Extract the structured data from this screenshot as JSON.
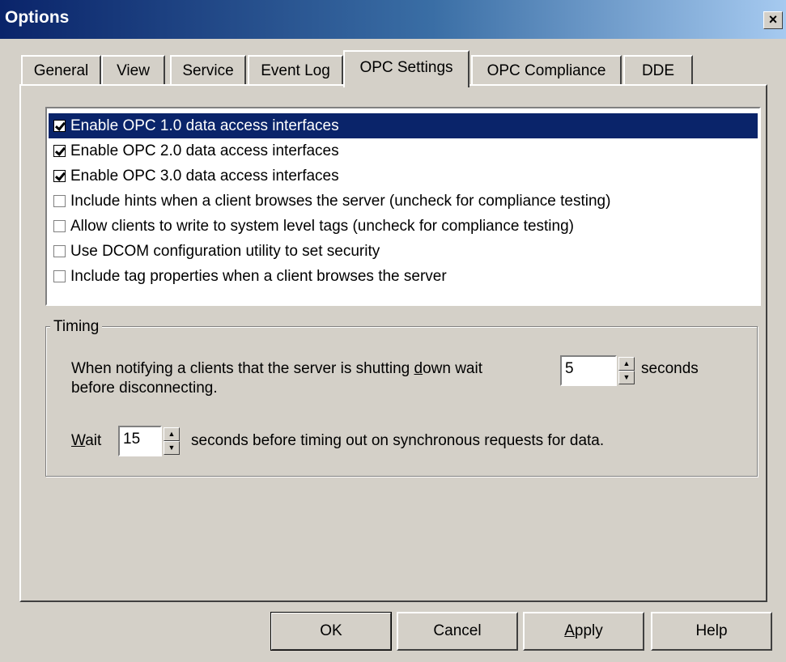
{
  "window": {
    "title": "Options",
    "close_glyph": "×"
  },
  "tabs": [
    {
      "label": "General"
    },
    {
      "label": "View"
    },
    {
      "label": "Service"
    },
    {
      "label": "Event Log"
    },
    {
      "label": "OPC Settings",
      "active": true
    },
    {
      "label": "OPC Compliance"
    },
    {
      "label": "DDE"
    }
  ],
  "options": [
    {
      "label": "Enable OPC 1.0 data access interfaces",
      "checked": true,
      "selected": true
    },
    {
      "label": "Enable OPC 2.0 data access interfaces",
      "checked": true
    },
    {
      "label": "Enable OPC 3.0 data access interfaces",
      "checked": true
    },
    {
      "label": "Include hints when a client browses the server (uncheck for compliance testing)",
      "checked": false
    },
    {
      "label": "Allow clients to write to system level tags (uncheck for compliance testing)",
      "checked": false
    },
    {
      "label": "Use DCOM configuration utility to set security",
      "checked": false
    },
    {
      "label": "Include tag properties when a client browses the server",
      "checked": false
    }
  ],
  "timing": {
    "legend": "Timing",
    "shutdown_text_1a": "When notifying a clients that the server is shutting ",
    "shutdown_text_1b": "d",
    "shutdown_text_1c": "own wait",
    "shutdown_text_2": "before disconnecting.",
    "shutdown_value": "5",
    "shutdown_units": "seconds",
    "wait_label_u": "W",
    "wait_label_rest": "ait",
    "wait_value": "15",
    "wait_suffix": "seconds before timing out on synchronous requests for data."
  },
  "buttons": {
    "ok": "OK",
    "cancel": "Cancel",
    "apply_u": "A",
    "apply_rest": "pply",
    "help": "Help"
  }
}
